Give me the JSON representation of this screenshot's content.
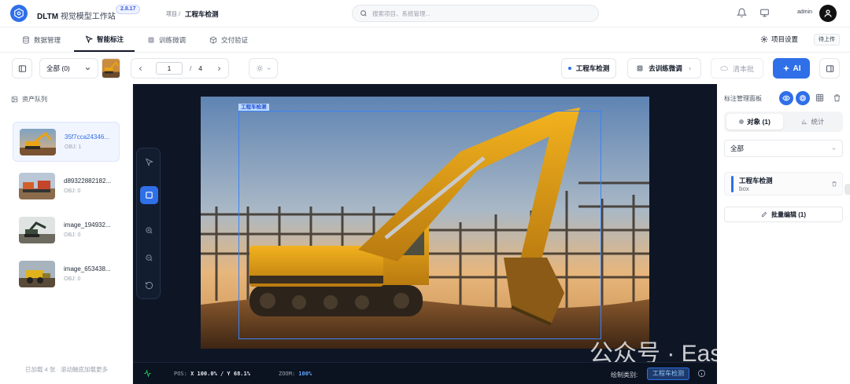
{
  "header": {
    "app_title": "DLTM",
    "app_subtitle": "视觉模型工作站",
    "version": "2.8.17",
    "breadcrumb_parent": "项目 /",
    "breadcrumb_current": "工程车检测",
    "search_placeholder": "搜索项目、系统管理...",
    "user": "admin"
  },
  "tabs": [
    {
      "label": "数据管理",
      "icon": "database-icon"
    },
    {
      "label": "智能标注",
      "icon": "cursor-icon",
      "active": true
    },
    {
      "label": "训练微调",
      "icon": "cpu-icon"
    },
    {
      "label": "交付验证",
      "icon": "package-icon"
    }
  ],
  "tabbar": {
    "project_settings": "项目设置",
    "pending_upload": "待上传"
  },
  "toolbar": {
    "filter_label": "全部 (0)",
    "page_current": "1",
    "page_separator": "/",
    "page_total": "4",
    "class_label": "工程车检测",
    "train_label": "去训练微调",
    "clear_label": "清本批",
    "ai_label": "AI"
  },
  "queue": {
    "title": "资产队列",
    "items": [
      {
        "name": "35f7cca24346...",
        "obj": "OBJ: 1",
        "selected": true
      },
      {
        "name": "d89322882182...",
        "obj": "OBJ: 0"
      },
      {
        "name": "image_194932...",
        "obj": "OBJ: 0"
      },
      {
        "name": "image_653438...",
        "obj": "OBJ: 0"
      }
    ],
    "footer": "已加载 4 张 · 滚动触底加载更多"
  },
  "canvas": {
    "bbox_label": "工程车检测",
    "status_pos_prefix": "POS:",
    "status_pos_value": "X 100.0% / Y 68.1%",
    "status_zoom_prefix": "ZOOM:",
    "status_zoom_value": "100%",
    "draw_class_label": "绘制类别:",
    "draw_class_value": "工程车检测",
    "watermark": "公众号 · EasyGBS"
  },
  "right_panel": {
    "title": "标注管理面板",
    "tab_objects": "对象 (1)",
    "tab_stats": "统计",
    "filter_value": "全部",
    "object_name": "工程车检测",
    "object_type": "box",
    "batch_edit": "批量编辑 (1)"
  },
  "colors": {
    "accent": "#2f6fe8",
    "canvas_bg": "#0e1626",
    "bbox": "#3b82f6"
  }
}
